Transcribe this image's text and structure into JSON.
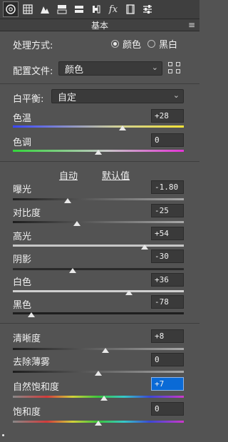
{
  "toolbar": {
    "icons": [
      "aperture-icon",
      "grid-icon",
      "mountain-icon",
      "split-panel-icon",
      "equal-icon",
      "lens-icon",
      "fx-icon",
      "film-icon",
      "sliders-icon"
    ],
    "fx_text": "fx"
  },
  "panel": {
    "title": "基本",
    "menu_icon": "menu-icon"
  },
  "treatment": {
    "label": "处理方式:",
    "options": [
      "颜色",
      "黑白"
    ],
    "selected": "颜色"
  },
  "profile": {
    "label": "配置文件:",
    "value": "颜色"
  },
  "white_balance": {
    "label": "白平衡:",
    "value": "自定"
  },
  "links": {
    "auto": "自动",
    "default": "默认值"
  },
  "sliders": [
    {
      "key": "temp",
      "label": "色温",
      "value": "+28",
      "level": 0.64
    },
    {
      "key": "tint",
      "label": "色调",
      "value": "0",
      "level": 0.5
    },
    {
      "key": "exposure",
      "label": "曝光",
      "value": "-1.80",
      "level": 0.32
    },
    {
      "key": "contrast",
      "label": "对比度",
      "value": "-25",
      "level": 0.375
    },
    {
      "key": "highlights",
      "label": "高光",
      "value": "+54",
      "level": 0.77
    },
    {
      "key": "shadows",
      "label": "阴影",
      "value": "-30",
      "level": 0.35
    },
    {
      "key": "whites",
      "label": "白色",
      "value": "+36",
      "level": 0.68
    },
    {
      "key": "blacks",
      "label": "黑色",
      "value": "-78",
      "level": 0.11
    },
    {
      "key": "clarity",
      "label": "清晰度",
      "value": "+8",
      "level": 0.54
    },
    {
      "key": "dehaze",
      "label": "去除薄雾",
      "value": "0",
      "level": 0.5
    },
    {
      "key": "vibrance",
      "label": "自然饱和度",
      "value": "+7",
      "level": 0.535
    },
    {
      "key": "saturation",
      "label": "饱和度",
      "value": "0",
      "level": 0.5
    }
  ]
}
